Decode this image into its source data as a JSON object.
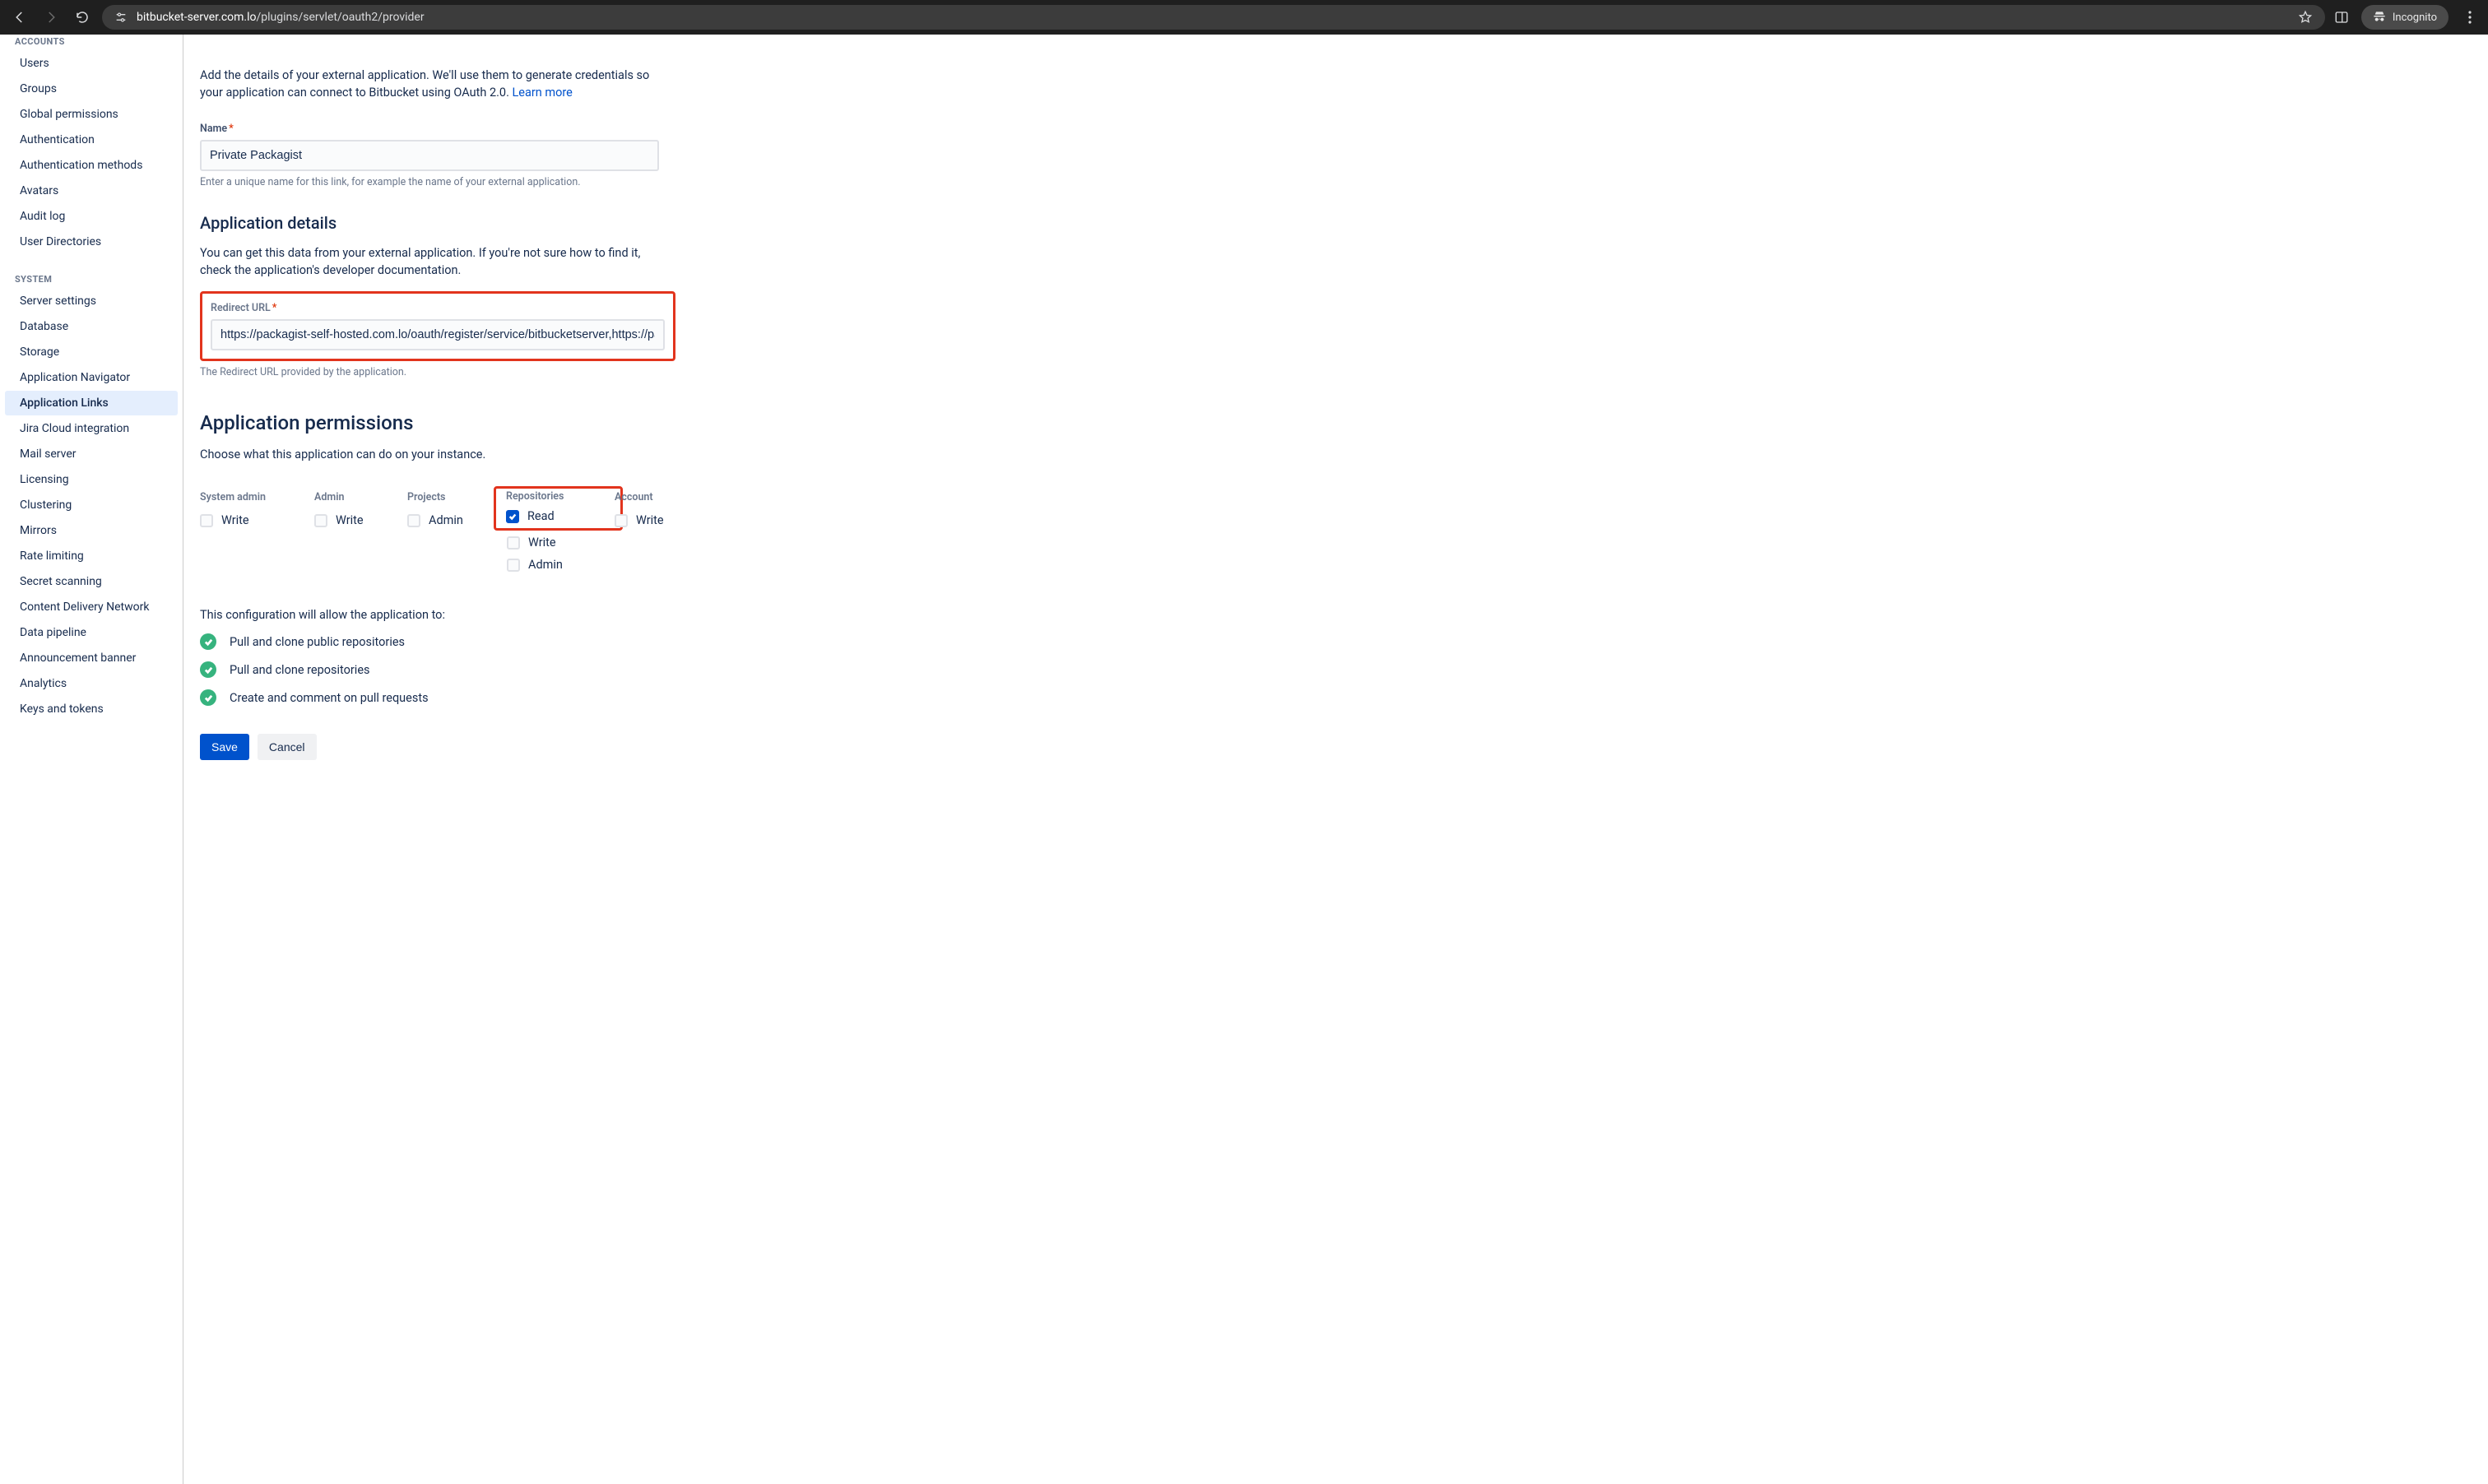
{
  "browser": {
    "url_domain": "bitbucket-server.com.lo",
    "url_path": "/plugins/servlet/oauth2/provider",
    "incognito_label": "Incognito"
  },
  "sidebar": {
    "accounts_header": "ACCOUNTS",
    "accounts": [
      {
        "label": "Users"
      },
      {
        "label": "Groups"
      },
      {
        "label": "Global permissions"
      },
      {
        "label": "Authentication"
      },
      {
        "label": "Authentication methods"
      },
      {
        "label": "Avatars"
      },
      {
        "label": "Audit log"
      },
      {
        "label": "User Directories"
      }
    ],
    "system_header": "SYSTEM",
    "system": [
      {
        "label": "Server settings"
      },
      {
        "label": "Database"
      },
      {
        "label": "Storage"
      },
      {
        "label": "Application Navigator"
      },
      {
        "label": "Application Links",
        "active": true
      },
      {
        "label": "Jira Cloud integration"
      },
      {
        "label": "Mail server"
      },
      {
        "label": "Licensing"
      },
      {
        "label": "Clustering"
      },
      {
        "label": "Mirrors"
      },
      {
        "label": "Rate limiting"
      },
      {
        "label": "Secret scanning"
      },
      {
        "label": "Content Delivery Network"
      },
      {
        "label": "Data pipeline"
      },
      {
        "label": "Announcement banner"
      },
      {
        "label": "Analytics"
      },
      {
        "label": "Keys and tokens"
      }
    ]
  },
  "main": {
    "intro_a": "Add the details of your external application. We'll use them to generate credentials so your application can connect to Bitbucket using OAuth 2.0. ",
    "intro_link": "Learn more",
    "name_label": "Name",
    "name_value": "Private Packagist",
    "name_help": "Enter a unique name for this link, for example the name of your external application.",
    "appdetails_heading": "Application details",
    "appdetails_desc": "You can get this data from your external application. If you're not sure how to find it, check the application's developer documentation.",
    "redirect_label": "Redirect URL",
    "redirect_value": "https://packagist-self-hosted.com.lo/oauth/register/service/bitbucketserver,https://packagi",
    "redirect_help": "The Redirect URL provided by the application.",
    "perm_heading": "Application permissions",
    "perm_desc": "Choose what this application can do on your instance.",
    "perm": {
      "system_admin": {
        "header": "System admin",
        "options": [
          {
            "label": "Write",
            "checked": false
          }
        ]
      },
      "admin": {
        "header": "Admin",
        "options": [
          {
            "label": "Write",
            "checked": false
          }
        ]
      },
      "projects": {
        "header": "Projects",
        "options": [
          {
            "label": "Admin",
            "checked": false
          }
        ]
      },
      "repositories": {
        "header": "Repositories",
        "options": [
          {
            "label": "Read",
            "checked": true
          },
          {
            "label": "Write",
            "checked": false
          },
          {
            "label": "Admin",
            "checked": false
          }
        ]
      },
      "account": {
        "header": "Account",
        "options": [
          {
            "label": "Write",
            "checked": false
          }
        ]
      }
    },
    "summary_intro": "This configuration will allow the application to:",
    "summary": [
      "Pull and clone public repositories",
      "Pull and clone repositories",
      "Create and comment on pull requests"
    ],
    "save_label": "Save",
    "cancel_label": "Cancel"
  }
}
